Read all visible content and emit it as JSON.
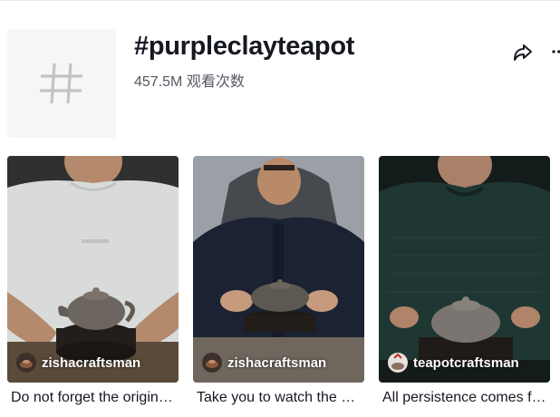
{
  "hashtag": {
    "title": "#purpleclayteapot",
    "views": "457.5M 观看次数",
    "icon": "hashtag-icon"
  },
  "actions": {
    "share_icon": "share-icon",
    "more_icon": "more-icon"
  },
  "videos": [
    {
      "author": "zishacraftsman",
      "caption": "Do not forget the original intention",
      "shirt_color": "#d9dcdb",
      "bg_color": "#2a2c2c"
    },
    {
      "author": "zishacraftsman",
      "caption": "Take you to watch the making",
      "shirt_color": "#1b2233",
      "bg_color": "#9ea3a8"
    },
    {
      "author": "teapotcraftsman",
      "caption": "All persistence comes from love",
      "shirt_color": "#1f3733",
      "bg_color": "#16201f"
    }
  ]
}
